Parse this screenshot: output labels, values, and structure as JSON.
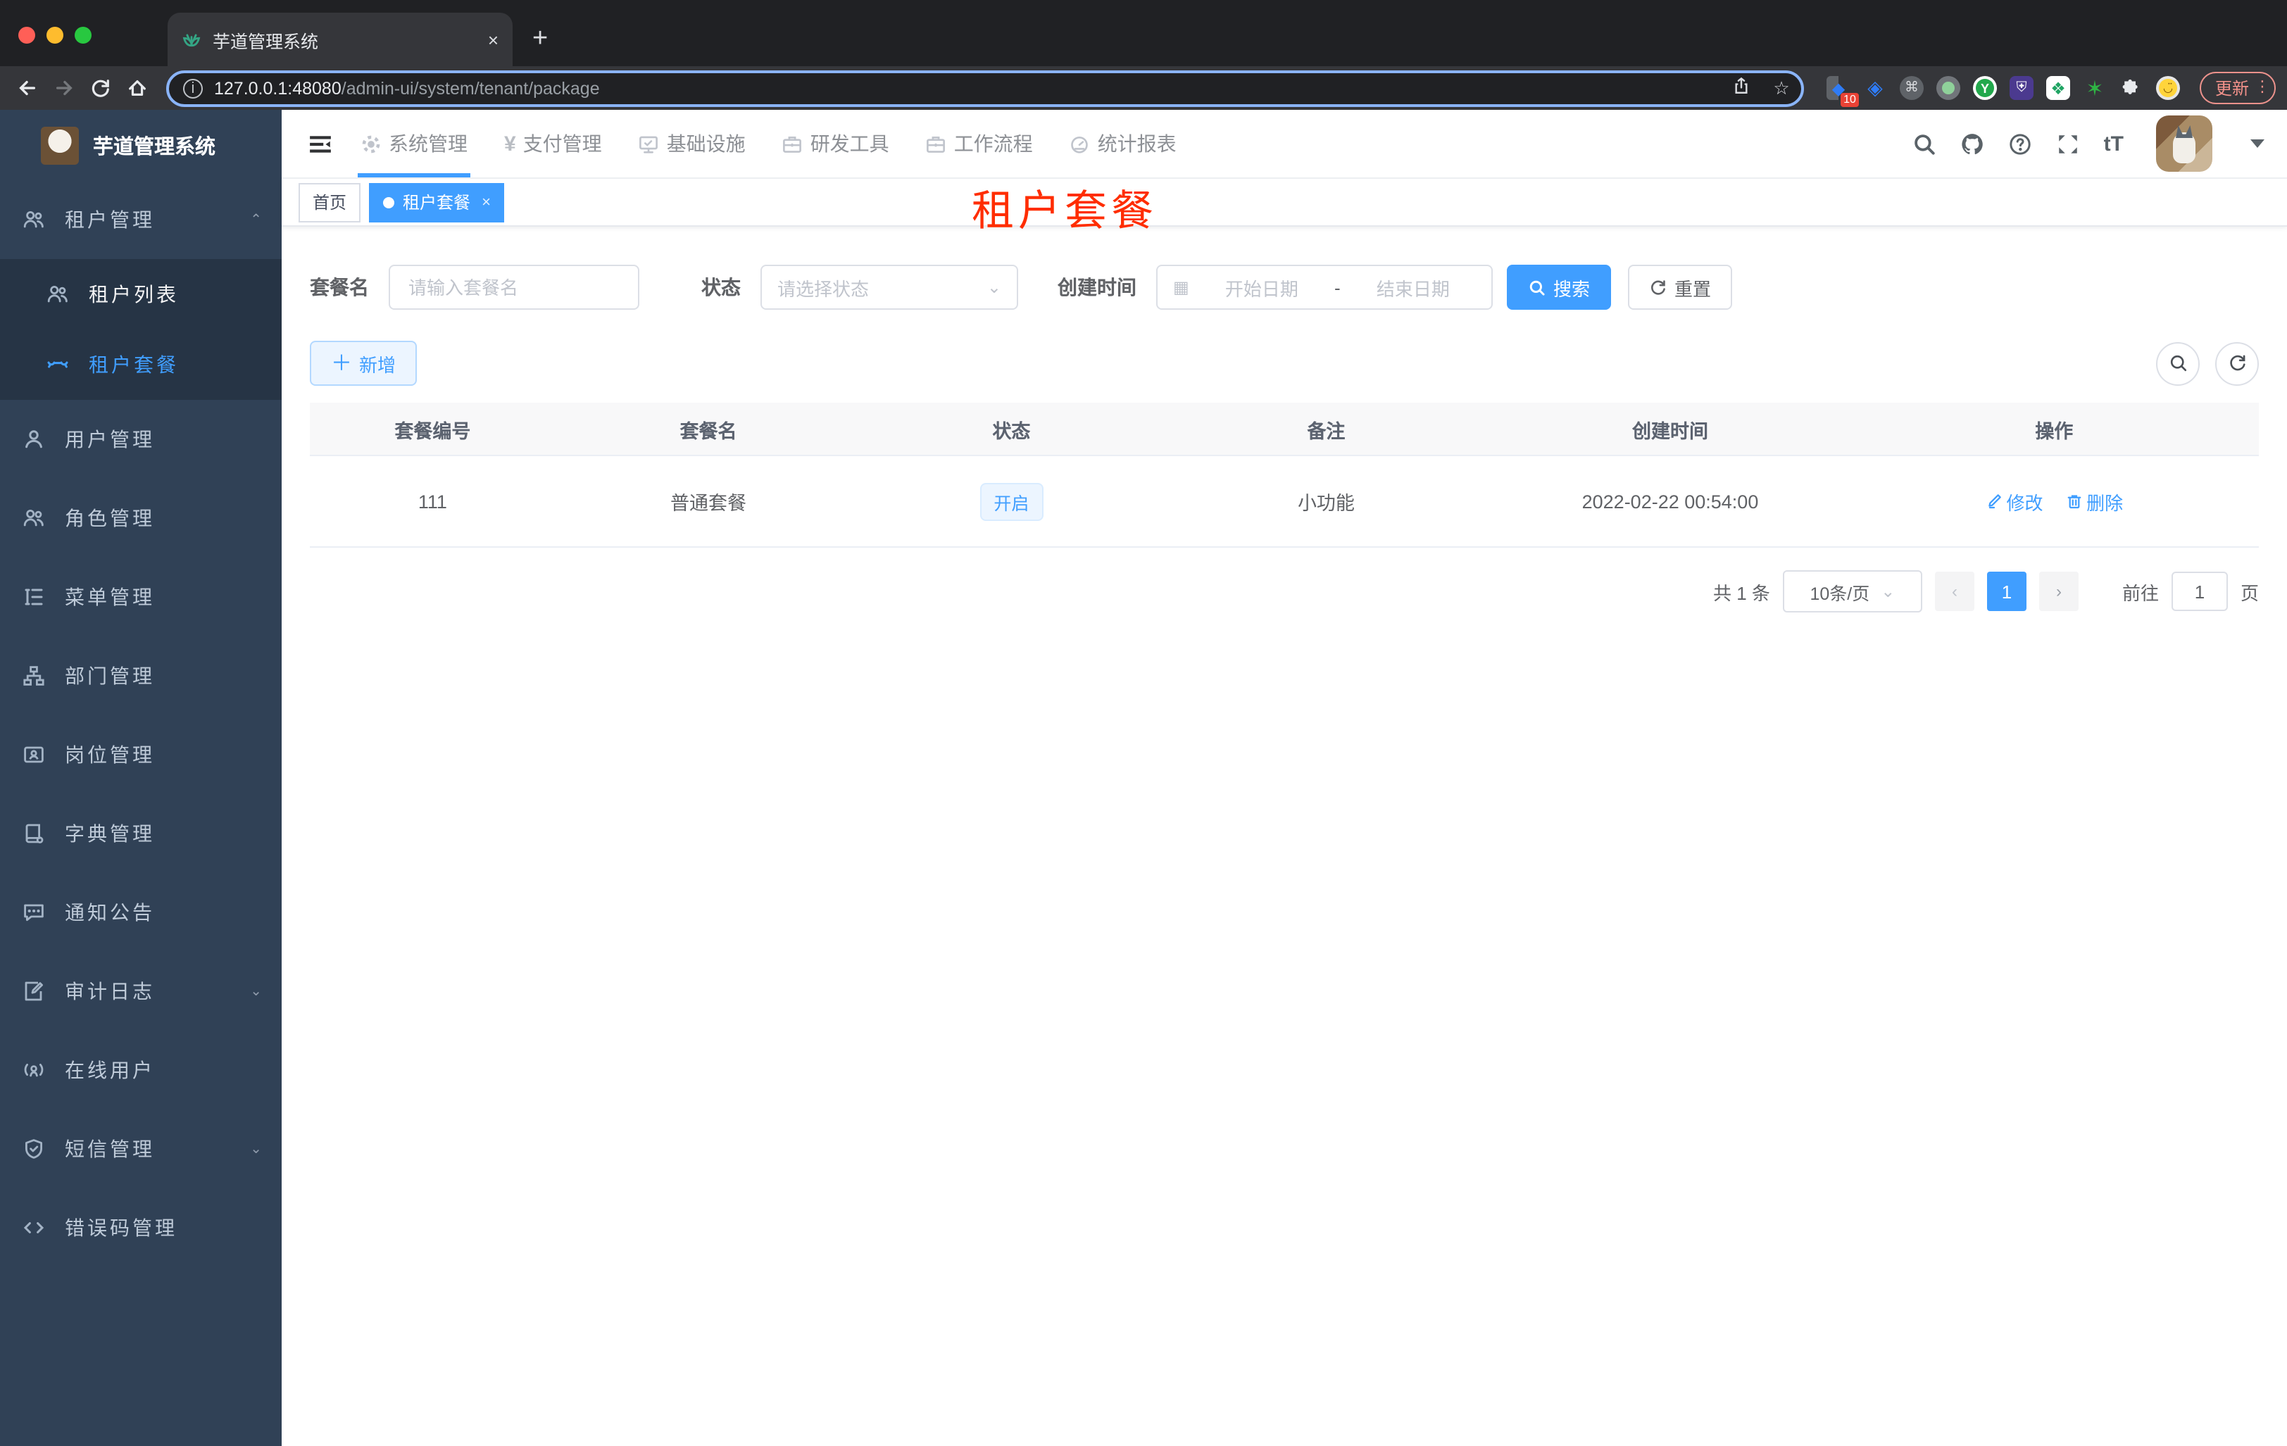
{
  "browser": {
    "tab_title": "芋道管理系统",
    "tab_close": "×",
    "new_tab": "+",
    "url_host": "127.0.0.1:48080",
    "url_path": "/admin-ui/system/tenant/package",
    "ext_badge": "10",
    "update_label": "更新"
  },
  "sidebar": {
    "title": "芋道管理系统",
    "items": [
      {
        "label": "租户管理"
      },
      {
        "label": "租户列表"
      },
      {
        "label": "租户套餐"
      },
      {
        "label": "用户管理"
      },
      {
        "label": "角色管理"
      },
      {
        "label": "菜单管理"
      },
      {
        "label": "部门管理"
      },
      {
        "label": "岗位管理"
      },
      {
        "label": "字典管理"
      },
      {
        "label": "通知公告"
      },
      {
        "label": "审计日志"
      },
      {
        "label": "在线用户"
      },
      {
        "label": "短信管理"
      },
      {
        "label": "错误码管理"
      }
    ]
  },
  "header": {
    "nav": [
      {
        "label": "系统管理"
      },
      {
        "label": "支付管理"
      },
      {
        "label": "基础设施"
      },
      {
        "label": "研发工具"
      },
      {
        "label": "工作流程"
      },
      {
        "label": "统计报表"
      }
    ],
    "font_icon": "tT"
  },
  "tags": {
    "home": "首页",
    "active": "租户套餐",
    "close": "×"
  },
  "annotation": "租户套餐",
  "filters": {
    "name_label": "套餐名",
    "name_placeholder": "请输入套餐名",
    "status_label": "状态",
    "status_placeholder": "请选择状态",
    "time_label": "创建时间",
    "start_placeholder": "开始日期",
    "range_separator": "-",
    "end_placeholder": "结束日期",
    "search_label": "搜索",
    "reset_label": "重置"
  },
  "toolbar": {
    "add_label": "新增"
  },
  "table": {
    "headers": [
      "套餐编号",
      "套餐名",
      "状态",
      "备注",
      "创建时间",
      "操作"
    ],
    "rows": [
      {
        "id": "111",
        "name": "普通套餐",
        "status": "开启",
        "remark": "小功能",
        "created": "2022-02-22 00:54:00",
        "edit": "修改",
        "delete": "删除"
      }
    ]
  },
  "pagination": {
    "total": "共 1 条",
    "page_size": "10条/页",
    "prev": "‹",
    "page": "1",
    "next": "›",
    "goto_label": "前往",
    "goto_value": "1",
    "unit_label": "页"
  },
  "colors": {
    "accent": "#409eff",
    "sidebar_bg": "#304156",
    "submenu_bg": "#263445",
    "annotation_red": "#ff2d00",
    "tag_open_bg": "#ecf5ff"
  }
}
